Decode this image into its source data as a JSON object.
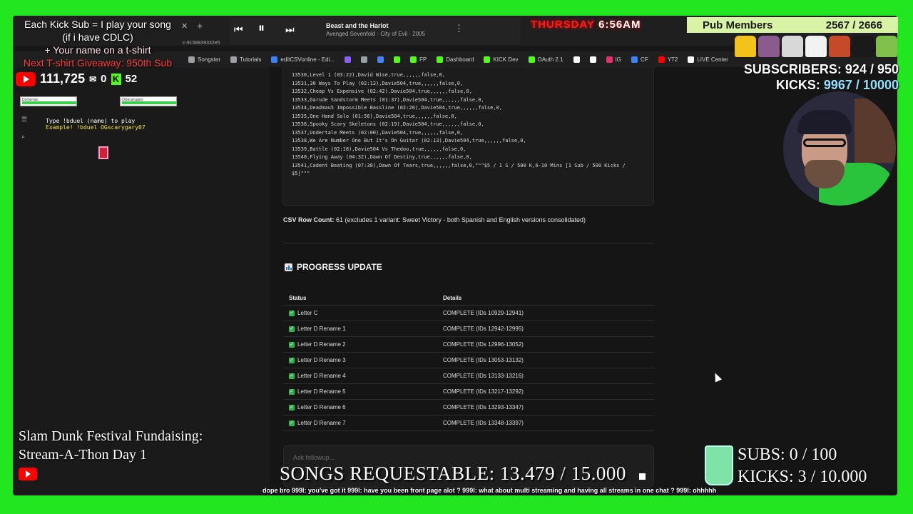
{
  "overlay": {
    "kick_sub_lines": [
      "Each Kick Sub = I play your song",
      "(if i have CDLC)",
      "+ Your name on a t-shirt",
      "Next T-shirt Giveaway: 950th Sub"
    ],
    "youtube_count": "111,725",
    "mail_count": "0",
    "kick_count": "52",
    "day": "THURSDAY",
    "time": "6:56AM",
    "pub_label": "Pub Members",
    "pub_value": "2567 / 2666",
    "subscribers": "SUBSCRIBERS: 924 / 950",
    "kicks_label": "KICKS:",
    "kicks_value": "9967 / 10000",
    "duel_name_1": "Dumerras",
    "duel_name_2": "OGscarygary",
    "duel_instruction": "Type !bduel (name) to play",
    "duel_example": "Example! !bduel OGscarygary07",
    "fund_line_1": "Slam Dunk Festival Fundaising:",
    "fund_line_2": "Stream-A-Thon Day 1",
    "songs_requestable": "SONGS REQUESTABLE: 13.479 / 15.000",
    "jar_subs": "SUBS:  0 / 100",
    "jar_kicks": "KICKS: 3 / 10.000",
    "chat_ticker": "dope bro  999l: you've got it  999l: have you been front page alot ?  999l: what about multi streaming and having all streams in one chat ?  999l: ohhhhh"
  },
  "player": {
    "song": "Beast and the Harlot",
    "artist": "Avenged Sevenfold · City of Evil · 2005"
  },
  "browser": {
    "url_fragment": "c-9158839332e5",
    "bookmarks": [
      {
        "label": "Songster",
        "color": "#9aa0a6"
      },
      {
        "label": "Tutorials",
        "color": "#9aa0a6"
      },
      {
        "label": "editCSVonline - Edi...",
        "color": "#3b82f6"
      },
      {
        "label": "",
        "color": "#8b5cf6"
      },
      {
        "label": "",
        "color": "#9aa0a6"
      },
      {
        "label": "",
        "color": "#4285f4"
      },
      {
        "label": "",
        "color": "#53fc18"
      },
      {
        "label": "FP",
        "color": "#53fc18"
      },
      {
        "label": "Dashboard",
        "color": "#53fc18"
      },
      {
        "label": "KICK Dev",
        "color": "#53fc18"
      },
      {
        "label": "OAuth 2.1",
        "color": "#53fc18"
      },
      {
        "label": "",
        "color": "#ffffff"
      },
      {
        "label": "",
        "color": "#ffffff"
      },
      {
        "label": "IG",
        "color": "#e1306c"
      },
      {
        "label": "CF",
        "color": "#3b82f6"
      },
      {
        "label": "YT2",
        "color": "#ff0000"
      },
      {
        "label": "LIVE Center",
        "color": "#ffffff"
      }
    ]
  },
  "code_lines": [
    "13530,Level 1 (03:22),David Wise,true,,,,,,false,0,",
    "13531,30 Ways To Play (02:13),Davie504,true,,,,,,false,0,",
    "13532,Cheap Vs Expensive (02:42),Davie504,true,,,,,,false,0,",
    "13533,Darude Sandstorm Meets (01:37),Davie504,true,,,,,,false,0,",
    "13534,Deadmau5 Impossible Bassline (02:20),Davie504,true,,,,,,false,0,",
    "13535,One Hand Solo (01:56),Davie504,true,,,,,,false,0,",
    "13536,Spooky Scary Skeletons (02:19),Davie504,true,,,,,,false,0,",
    "13537,Undertale Meets (02:00),Davie504,true,,,,,,false,0,",
    "13538,We Are Number One But It's On Guitar (02:13),Davie504,true,,,,,,false,0,",
    "13539,Battle (02:18),Davie504 Vs Thedoo,true,,,,,,false,0,",
    "13540,Flying Away (04:32),Dawn Of Destiny,true,,,,,,false,0,",
    "13541,Cadent Beating (07:38),Dawn Of Tears,true,,,,,,false,0,\"\"\"$5 / 1 S / 500 K,6-10 Mins [1 Sub / 500 Kicks /",
    "$5]\"\"\""
  ],
  "csv": {
    "label": "CSV Row Count:",
    "text": " 61 (excludes 1 variant: Sweet Victory - both Spanish and English versions consolidated)"
  },
  "progress": {
    "title": "PROGRESS UPDATE",
    "headers": [
      "Status",
      "Details"
    ],
    "rows": [
      [
        "Letter C",
        "COMPLETE (IDs 10929-12941)"
      ],
      [
        "Letter D Rename 1",
        "COMPLETE (IDs 12942-12995)"
      ],
      [
        "Letter D Rename 2",
        "COMPLETE (IDs 12996-13052)"
      ],
      [
        "Letter D Rename 3",
        "COMPLETE (IDs 13053-13132)"
      ],
      [
        "Letter D Rename 4",
        "COMPLETE (IDs 13133-13216)"
      ],
      [
        "Letter D Rename 5",
        "COMPLETE (IDs 13217-13292)"
      ],
      [
        "Letter D Rename 6",
        "COMPLETE (IDs 13293-13347)"
      ],
      [
        "Letter D Rename 7",
        "COMPLETE (IDs 13348-13397)"
      ]
    ]
  },
  "followup": {
    "placeholder": "Ask followup..."
  }
}
